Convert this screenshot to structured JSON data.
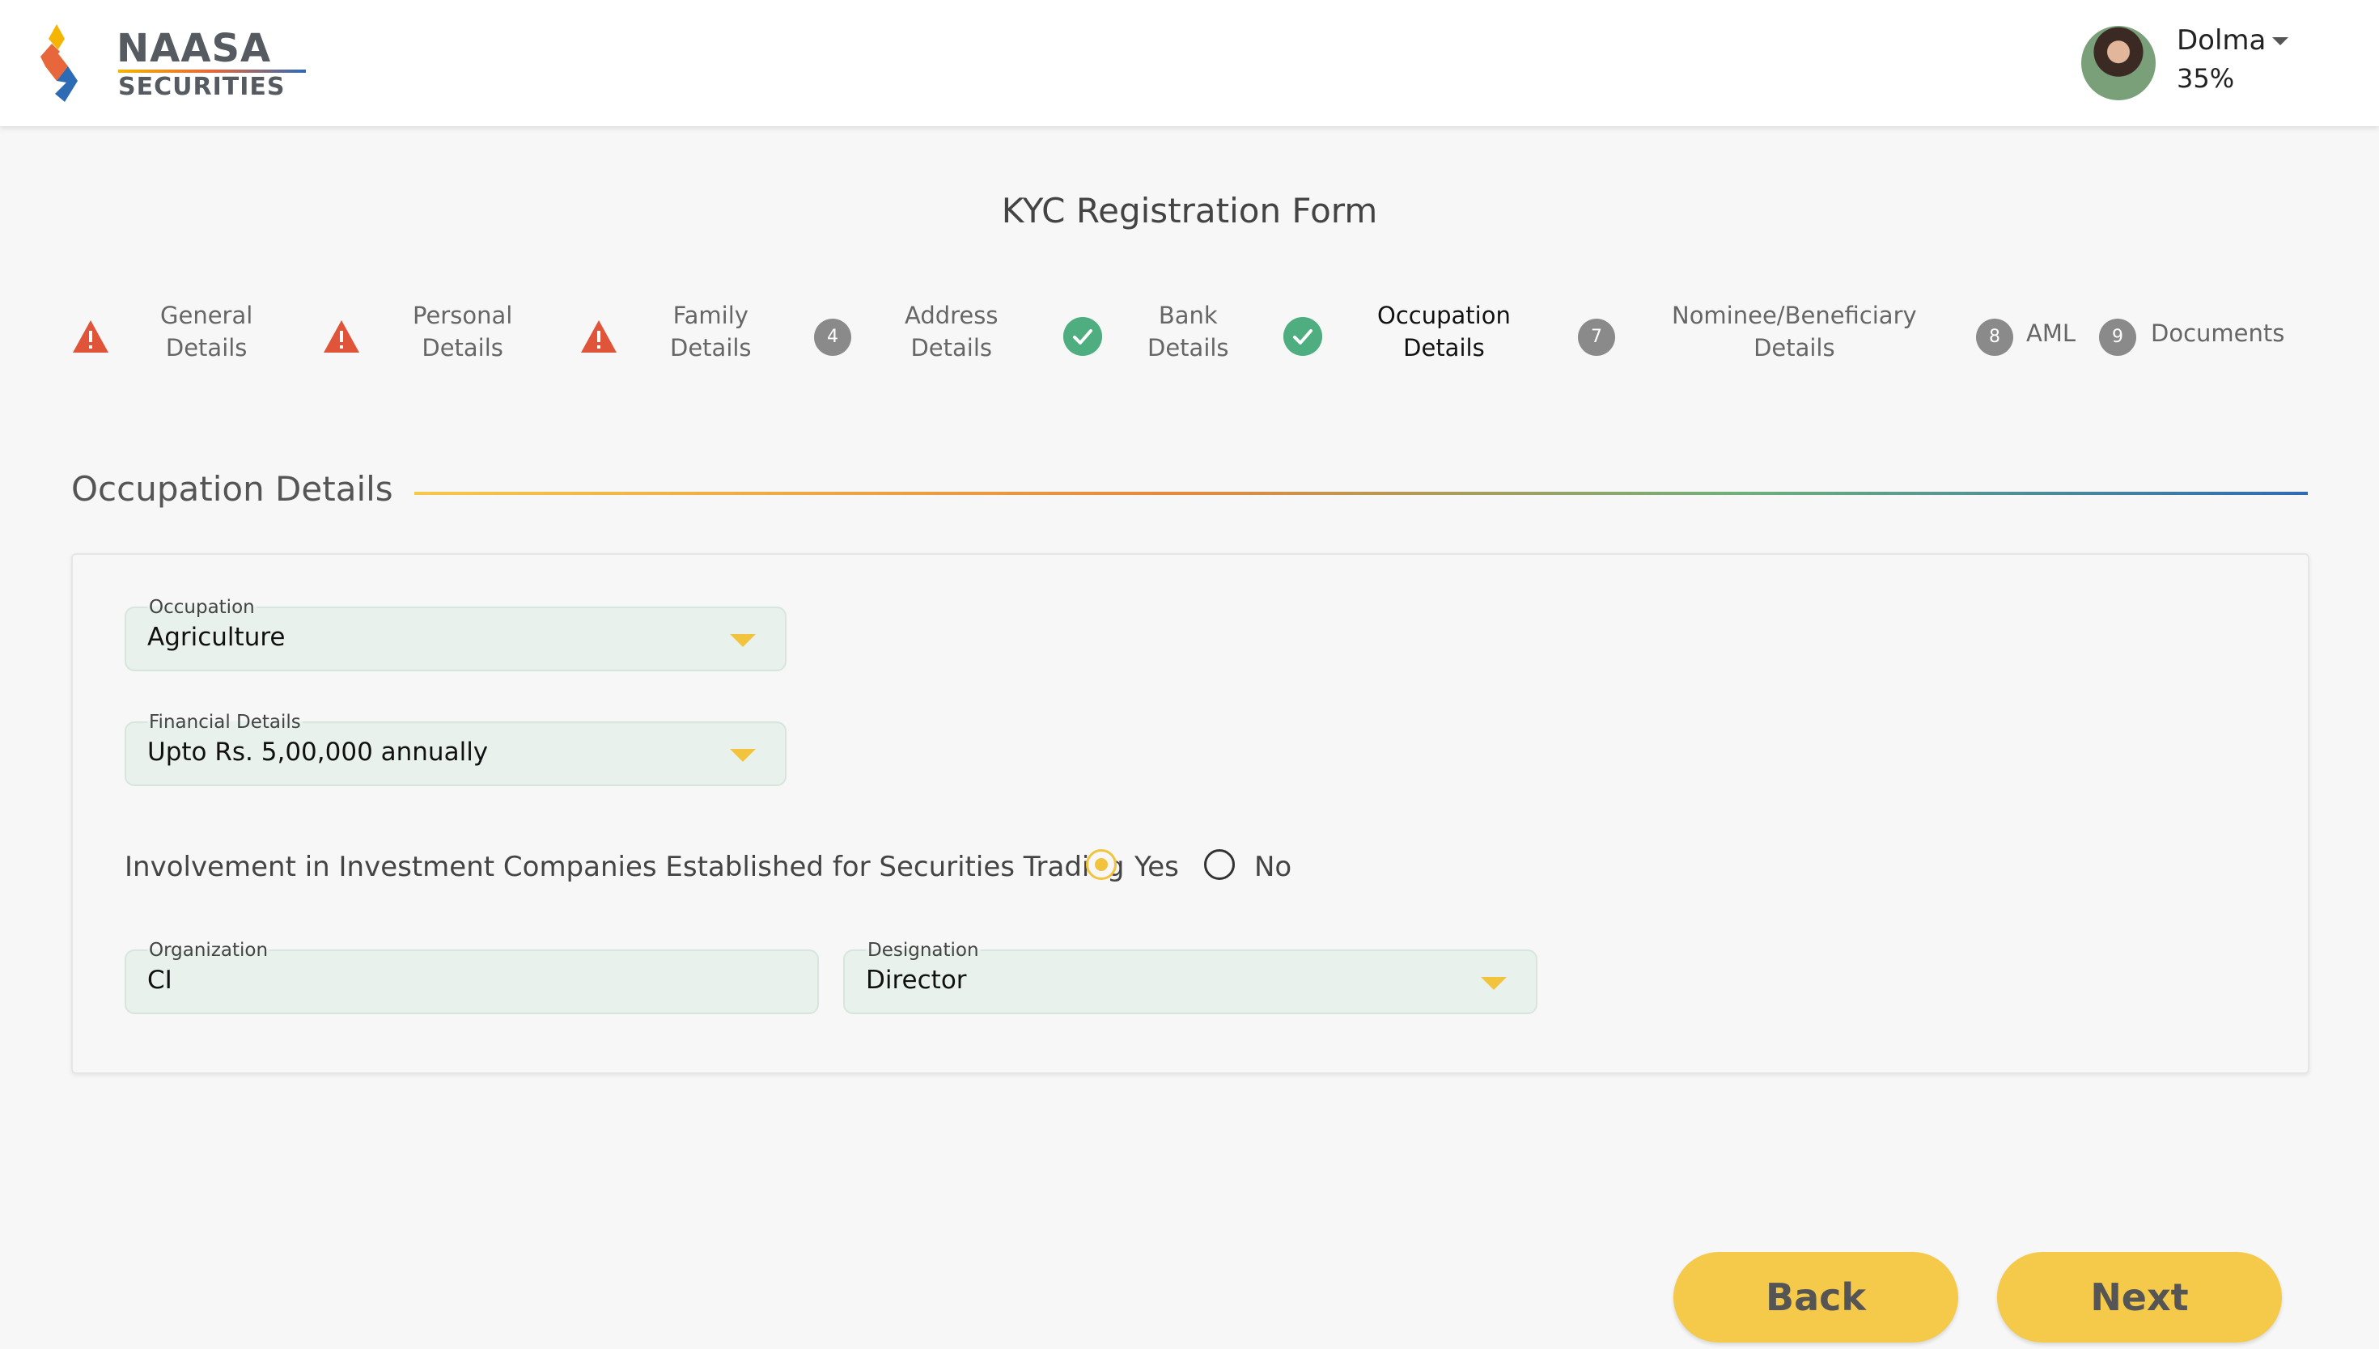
{
  "header": {
    "logo_title": "NAASA",
    "logo_subtitle": "SECURITIES",
    "user_name": "Dolma",
    "user_progress": "35%"
  },
  "page_title": "KYC Registration Form",
  "steps": [
    {
      "label_line1": "General",
      "label_line2": "Details",
      "status": "warning"
    },
    {
      "label_line1": "Personal",
      "label_line2": "Details",
      "status": "warning"
    },
    {
      "label_line1": "Family",
      "label_line2": "Details",
      "status": "warning"
    },
    {
      "number": "4",
      "label_line1": "Address",
      "label_line2": "Details",
      "status": "pending"
    },
    {
      "label_line1": "Bank",
      "label_line2": "Details",
      "status": "complete"
    },
    {
      "label_line1": "Occupation",
      "label_line2": "Details",
      "status": "complete",
      "active": true
    },
    {
      "number": "7",
      "label_line1": "Nominee/Beneficiary",
      "label_line2": "Details",
      "status": "pending"
    },
    {
      "number": "8",
      "label_line1": "AML",
      "status": "pending"
    },
    {
      "number": "9",
      "label_line1": "Documents",
      "status": "pending"
    }
  ],
  "section": {
    "title": "Occupation Details"
  },
  "form": {
    "occupation": {
      "label": "Occupation",
      "value": "Agriculture"
    },
    "financial": {
      "label": "Financial Details",
      "value": "Upto Rs. 5,00,000 annually"
    },
    "involvement": {
      "question": "Involvement in Investment Companies Established for Securities Trading",
      "options": [
        "Yes",
        "No"
      ],
      "selected": "Yes"
    },
    "organization": {
      "label": "Organization",
      "value": "CI"
    },
    "designation": {
      "label": "Designation",
      "value": "Director"
    }
  },
  "buttons": {
    "back": "Back",
    "next": "Next"
  },
  "colors": {
    "accent_yellow": "#f5c94a",
    "warning": "#e0553a",
    "success": "#4eae7f",
    "field_bg": "#e8f1ec"
  }
}
